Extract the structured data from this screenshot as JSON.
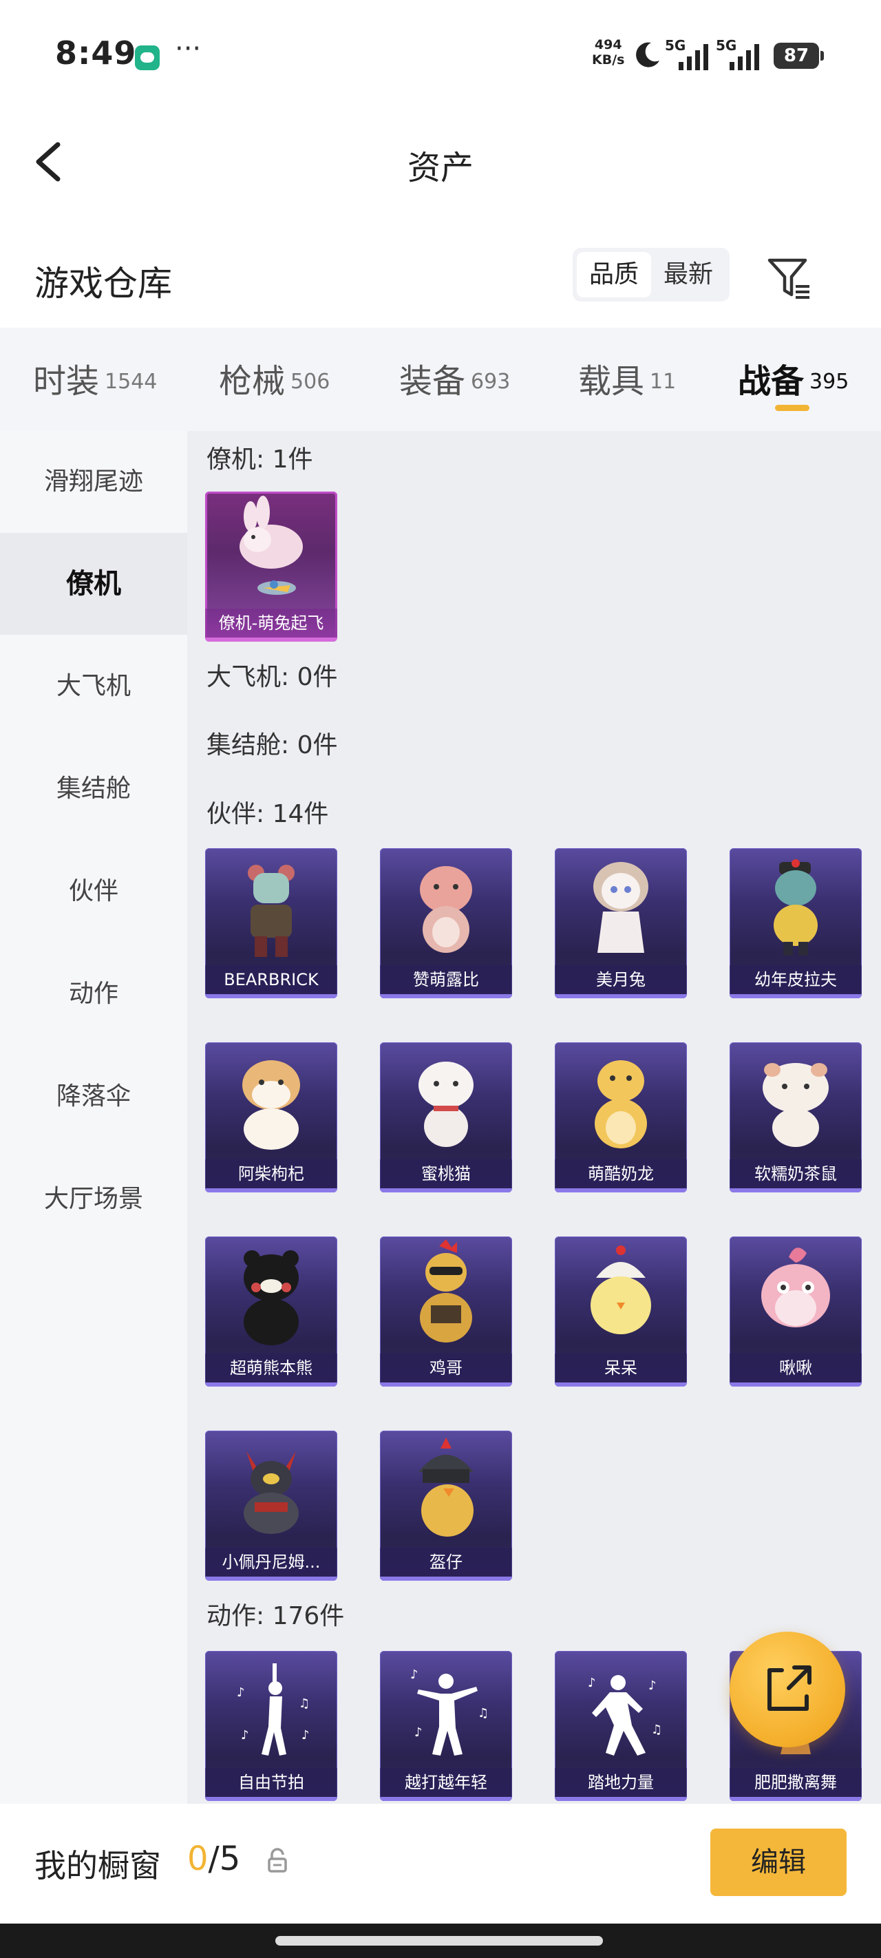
{
  "status_bar": {
    "time": "8:49",
    "more": "···",
    "speed_value": "494",
    "speed_unit": "KB/s",
    "net1": "5G",
    "net2": "5G",
    "battery": "87"
  },
  "nav": {
    "title": "资产"
  },
  "warehouse": {
    "title": "游戏仓库",
    "sort_options": [
      "品质",
      "最新"
    ]
  },
  "tabs": [
    {
      "label": "时装",
      "count": "1544"
    },
    {
      "label": "枪械",
      "count": "506"
    },
    {
      "label": "装备",
      "count": "693"
    },
    {
      "label": "载具",
      "count": "11"
    },
    {
      "label": "战备",
      "count": "395"
    }
  ],
  "active_tab": "战备",
  "sidebar": {
    "items": [
      "滑翔尾迹",
      "僚机",
      "大飞机",
      "集结舱",
      "伙伴",
      "动作",
      "降落伞",
      "大厅场景"
    ],
    "active": "僚机"
  },
  "sections": [
    {
      "label": "僚机: 1件",
      "items": [
        "僚机-萌兔起飞"
      ]
    },
    {
      "label": "大飞机: 0件",
      "items": []
    },
    {
      "label": "集结舱: 0件",
      "items": []
    },
    {
      "label": "伙伴: 14件",
      "items": [
        "BEARBRICK",
        "赞萌露比",
        "美月兔",
        "幼年皮拉夫",
        "阿柴枸杞",
        "蜜桃猫",
        "萌酷奶龙",
        "软糯奶茶鼠",
        "超萌熊本熊",
        "鸡哥",
        "呆呆",
        "啾啾",
        "小佩丹尼姆...",
        "盔仔"
      ]
    },
    {
      "label": "动作: 176件",
      "items": [
        "自由节拍",
        "越打越年轻",
        "踏地力量",
        "肥肥撒离舞"
      ]
    }
  ],
  "showcase": {
    "label": "我的橱窗",
    "current": "0",
    "max": "/5",
    "edit_label": "编辑"
  },
  "colors": {
    "accent": "#f2b433",
    "card_purple": "#3a3070",
    "card_pink": "#c04dc8"
  }
}
